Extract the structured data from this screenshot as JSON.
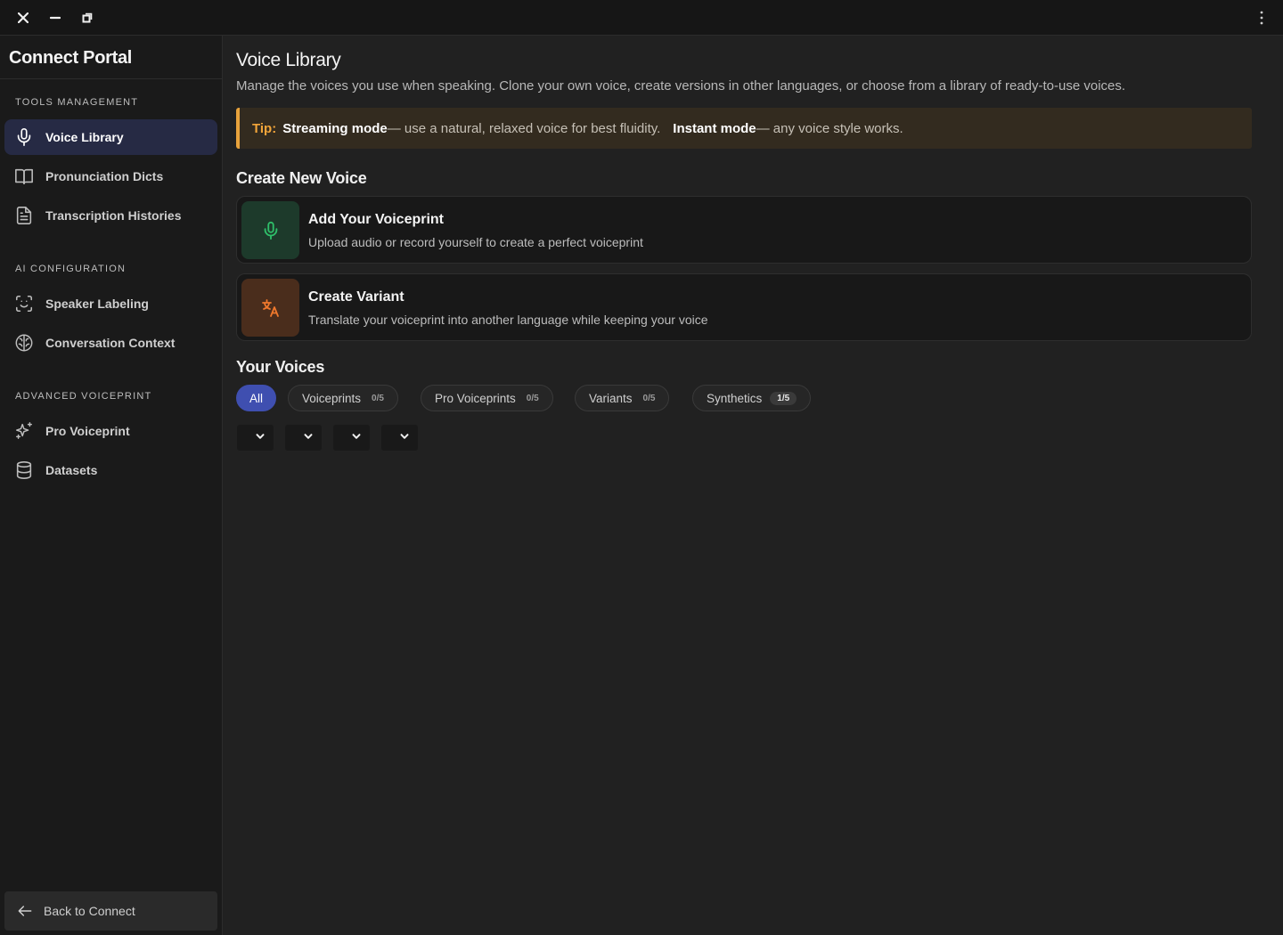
{
  "window": {
    "controls": [
      "close-icon",
      "minimize-icon",
      "restore-icon"
    ],
    "menu_icon": "kebab-menu-icon"
  },
  "sidebar": {
    "brand": "Connect Portal",
    "sections": [
      {
        "label": "TOOLS MANAGEMENT",
        "items": [
          {
            "label": "Voice Library",
            "icon": "microphone-icon",
            "active": true
          },
          {
            "label": "Pronunciation Dicts",
            "icon": "book-icon",
            "active": false
          },
          {
            "label": "Transcription Histories",
            "icon": "document-icon",
            "active": false
          }
        ]
      },
      {
        "label": "AI CONFIGURATION",
        "items": [
          {
            "label": "Speaker Labeling",
            "icon": "face-scan-icon",
            "active": false
          },
          {
            "label": "Conversation Context",
            "icon": "brain-icon",
            "active": false
          }
        ]
      },
      {
        "label": "ADVANCED VOICEPRINT",
        "items": [
          {
            "label": "Pro Voiceprint",
            "icon": "sparkles-icon",
            "active": false
          },
          {
            "label": "Datasets",
            "icon": "database-icon",
            "active": false
          }
        ]
      }
    ],
    "back_label": "Back to Connect"
  },
  "main": {
    "title": "Voice Library",
    "subtitle": "Manage the voices you use when speaking. Clone your own voice, create versions in other languages, or choose from a library of ready-to-use voices.",
    "tip": {
      "label": "Tip:",
      "mode1": "Streaming mode",
      "text1": " — use a natural, relaxed voice for best fluidity.",
      "mode2": "Instant mode",
      "text2": " — any voice style works."
    },
    "create_heading": "Create New Voice",
    "cards": [
      {
        "title": "Add Your Voiceprint",
        "desc": "Upload audio or record yourself to create a perfect voiceprint",
        "icon": "microphone-icon",
        "color": "#2fbf6a"
      },
      {
        "title": "Create Variant",
        "desc": "Translate your voiceprint into another language while keeping your voice",
        "icon": "translate-icon",
        "color": "#f0782c"
      }
    ],
    "voices_heading": "Your Voices",
    "filters": [
      {
        "label": "All",
        "count": "",
        "active": true
      },
      {
        "label": "Voiceprints",
        "count": "0/5",
        "active": false
      },
      {
        "label": "Pro Voiceprints",
        "count": "0/5",
        "active": false
      },
      {
        "label": "Variants",
        "count": "0/5",
        "active": false
      },
      {
        "label": "Synthetics",
        "count": "1/5",
        "active": false
      }
    ],
    "dropdowns": [
      "chevron-down-icon",
      "chevron-down-icon",
      "chevron-down-icon",
      "chevron-down-icon"
    ],
    "accent": "#3f4fb0",
    "tip_accent": "#e7a23c"
  }
}
